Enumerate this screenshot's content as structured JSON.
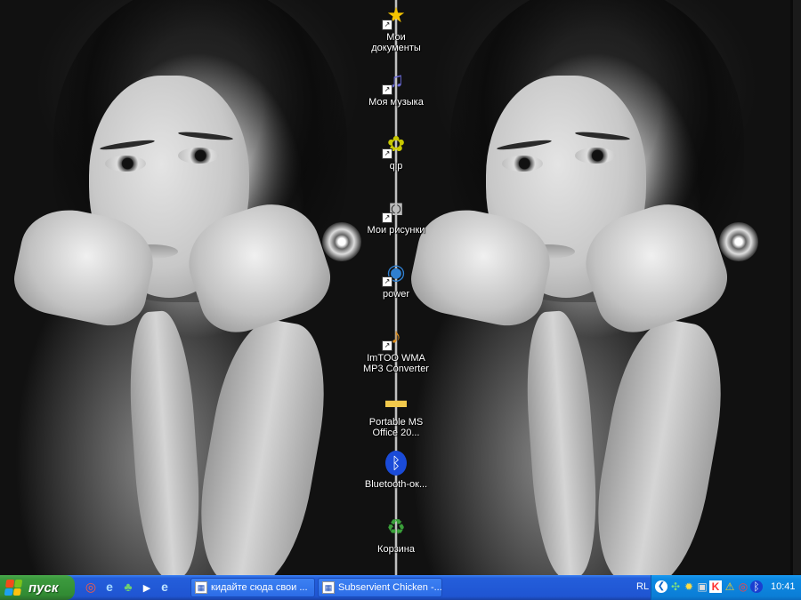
{
  "desktop_icons": [
    {
      "label": "Мои\nдокументы",
      "icon": "my-documents-star-icon",
      "glyph": "★",
      "color": "#f5c400"
    },
    {
      "label": "Моя музыка",
      "icon": "my-music-icon",
      "glyph": "♫",
      "color": "#6a6ad8"
    },
    {
      "label": "qip",
      "icon": "qip-messenger-icon",
      "glyph": "✿",
      "color": "#c8c800"
    },
    {
      "label": "Мои рисунки",
      "icon": "my-pictures-camera-icon",
      "glyph": "◙",
      "color": "#8a8a8a"
    },
    {
      "label": "power",
      "icon": "power-globe-icon",
      "glyph": "◉",
      "color": "#2f7fd0"
    },
    {
      "label": "ImTOO WMA\nMP3 Converter",
      "icon": "imtoo-converter-icon",
      "glyph": "♪",
      "color": "#e09020"
    },
    {
      "label": "Portable MS\nOffice 20...",
      "icon": "folder-icon",
      "glyph": "▬",
      "color": "#f2c94c"
    },
    {
      "label": "Bluetooth-ок...",
      "icon": "bluetooth-icon",
      "glyph": "ᛒ",
      "color": "#1a4bd8"
    },
    {
      "label": "Корзина",
      "icon": "recycle-bin-icon",
      "glyph": "♻",
      "color": "#3aa03a"
    }
  ],
  "taskbar": {
    "start_label": "пуск",
    "quick_launch": [
      {
        "icon": "opera-icon",
        "glyph": "◎",
        "color": "#e03020"
      },
      {
        "icon": "internet-explorer-icon",
        "glyph": "e",
        "color": "#7fc4ff"
      },
      {
        "icon": "messenger-icon",
        "glyph": "♣",
        "color": "#6fd06f"
      },
      {
        "icon": "media-player-icon",
        "glyph": "▶",
        "color": "#ffffff"
      },
      {
        "icon": "browser-icon",
        "glyph": "e",
        "color": "#bfe3ff"
      }
    ],
    "tasks": [
      {
        "label": "кидайте сюда свои ..."
      },
      {
        "label": "Subservient Chicken -..."
      }
    ],
    "language": "RL",
    "tray_icons": [
      {
        "icon": "network-icon",
        "glyph": "✣",
        "color": "#7fe07f"
      },
      {
        "icon": "gear-icon",
        "glyph": "✹",
        "color": "#ffdd44"
      },
      {
        "icon": "monitor-icon",
        "glyph": "▣",
        "color": "#dddddd"
      },
      {
        "icon": "antivirus-icon",
        "glyph": "K",
        "color": "#ff3030"
      },
      {
        "icon": "warning-icon",
        "glyph": "⚠",
        "color": "#ffd21f"
      },
      {
        "icon": "opera-tray-icon",
        "glyph": "◎",
        "color": "#ff4040"
      },
      {
        "icon": "bluetooth-tray-icon",
        "glyph": "ᛒ",
        "color": "#1a3fd0"
      }
    ],
    "clock": "10:41"
  }
}
